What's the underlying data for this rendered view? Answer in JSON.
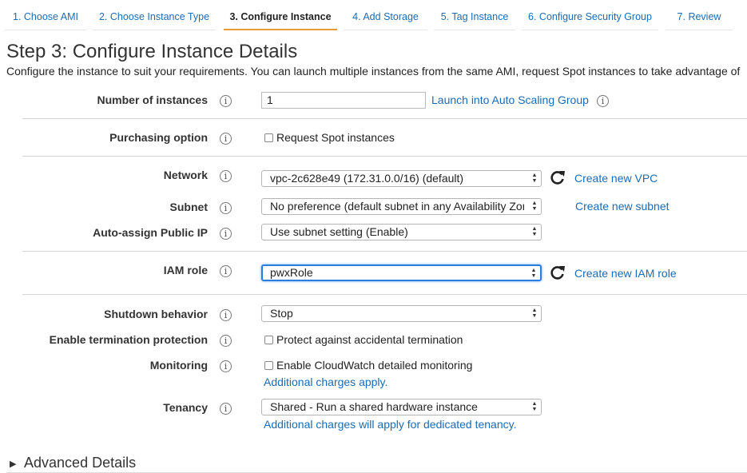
{
  "tabs": [
    {
      "label": "1. Choose AMI"
    },
    {
      "label": "2. Choose Instance Type"
    },
    {
      "label": "3. Configure Instance"
    },
    {
      "label": "4. Add Storage"
    },
    {
      "label": "5. Tag Instance"
    },
    {
      "label": "6. Configure Security Group"
    },
    {
      "label": "7. Review"
    }
  ],
  "page": {
    "title": "Step 3: Configure Instance Details",
    "subtitle": "Configure the instance to suit your requirements. You can launch multiple instances from the same AMI, request Spot instances to take advantage of"
  },
  "form": {
    "instances": {
      "label": "Number of instances",
      "value": "1",
      "link": "Launch into Auto Scaling Group"
    },
    "purchasing": {
      "label": "Purchasing option",
      "checkbox": "Request Spot instances"
    },
    "network": {
      "label": "Network",
      "value": "vpc-2c628e49 (172.31.0.0/16) (default)",
      "link": "Create new VPC"
    },
    "subnet": {
      "label": "Subnet",
      "value": "No preference (default subnet in any Availability Zone)",
      "link": "Create new subnet"
    },
    "public_ip": {
      "label": "Auto-assign Public IP",
      "value": "Use subnet setting (Enable)"
    },
    "iam": {
      "label": "IAM role",
      "value": "pwxRole",
      "link": "Create new IAM role"
    },
    "shutdown": {
      "label": "Shutdown behavior",
      "value": "Stop"
    },
    "termination": {
      "label": "Enable termination protection",
      "checkbox": "Protect against accidental termination"
    },
    "monitoring": {
      "label": "Monitoring",
      "checkbox": "Enable CloudWatch detailed monitoring",
      "note": "Additional charges apply."
    },
    "tenancy": {
      "label": "Tenancy",
      "value": "Shared - Run a shared hardware instance",
      "note": "Additional charges will apply for dedicated tenancy."
    }
  },
  "advanced": {
    "label": "Advanced Details"
  },
  "icons": {
    "info": "info-icon",
    "refresh": "refresh-icon",
    "dropdown": "updown-arrows-icon",
    "expand": "caret-right-icon"
  },
  "colors": {
    "link": "#1b6bb5",
    "active_tab_underline": "#ec9b34",
    "focus": "#2a7fde"
  }
}
